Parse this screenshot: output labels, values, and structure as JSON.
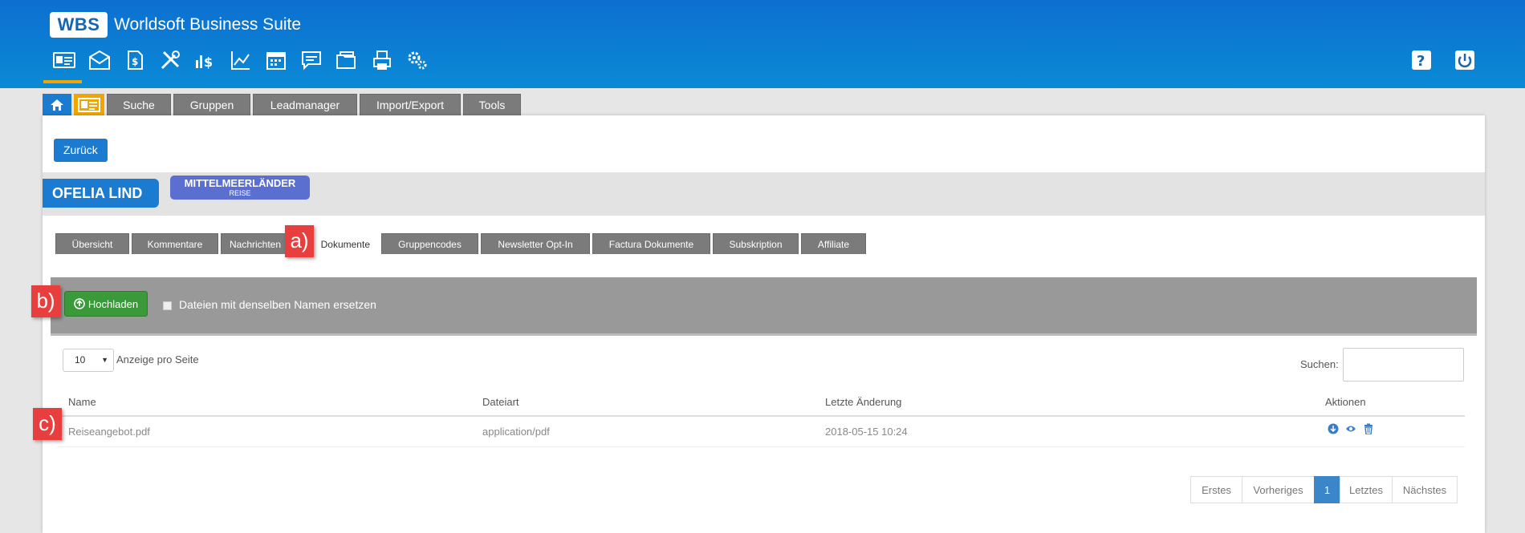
{
  "header": {
    "logo": "WBS",
    "app_title": "Worldsoft Business Suite",
    "icons": [
      "contact-card-icon",
      "mail-icon",
      "document-dollar-icon",
      "tools-icon",
      "finance-icon",
      "chart-icon",
      "calendar-icon",
      "message-icon",
      "folders-icon",
      "print-document-icon",
      "settings-gears-icon"
    ],
    "accent_color": "#f0a500"
  },
  "main_tabs": [
    "Suche",
    "Gruppen",
    "Leadmanager",
    "Import/Export",
    "Tools"
  ],
  "back_label": "Zurück",
  "contact": {
    "name": "OFELIA LIND",
    "group": "MITTELMEERLÄNDER",
    "group_sub": "REISE"
  },
  "sub_tabs": [
    "Übersicht",
    "Kommentare",
    "Nachrichten",
    "Dokumente",
    "Gruppencodes",
    "Newsletter Opt-In",
    "Factura Dokumente",
    "Subskription",
    "Affiliate"
  ],
  "upload": {
    "button": "Hochladen",
    "replace_label": "Dateien mit denselben Namen ersetzen"
  },
  "list": {
    "per_page_value": "10",
    "per_page_label": "Anzeige pro Seite",
    "search_label": "Suchen:",
    "columns": [
      "Name",
      "Dateiart",
      "Letzte Änderung",
      "Aktionen"
    ],
    "rows": [
      {
        "name": "Reiseangebot.pdf",
        "type": "application/pdf",
        "modified": "2018-05-15 10:24"
      }
    ]
  },
  "pagination": [
    "Erstes",
    "Vorheriges",
    "1",
    "Letztes",
    "Nächstes"
  ],
  "callouts": [
    "a)",
    "b)",
    "c)"
  ]
}
